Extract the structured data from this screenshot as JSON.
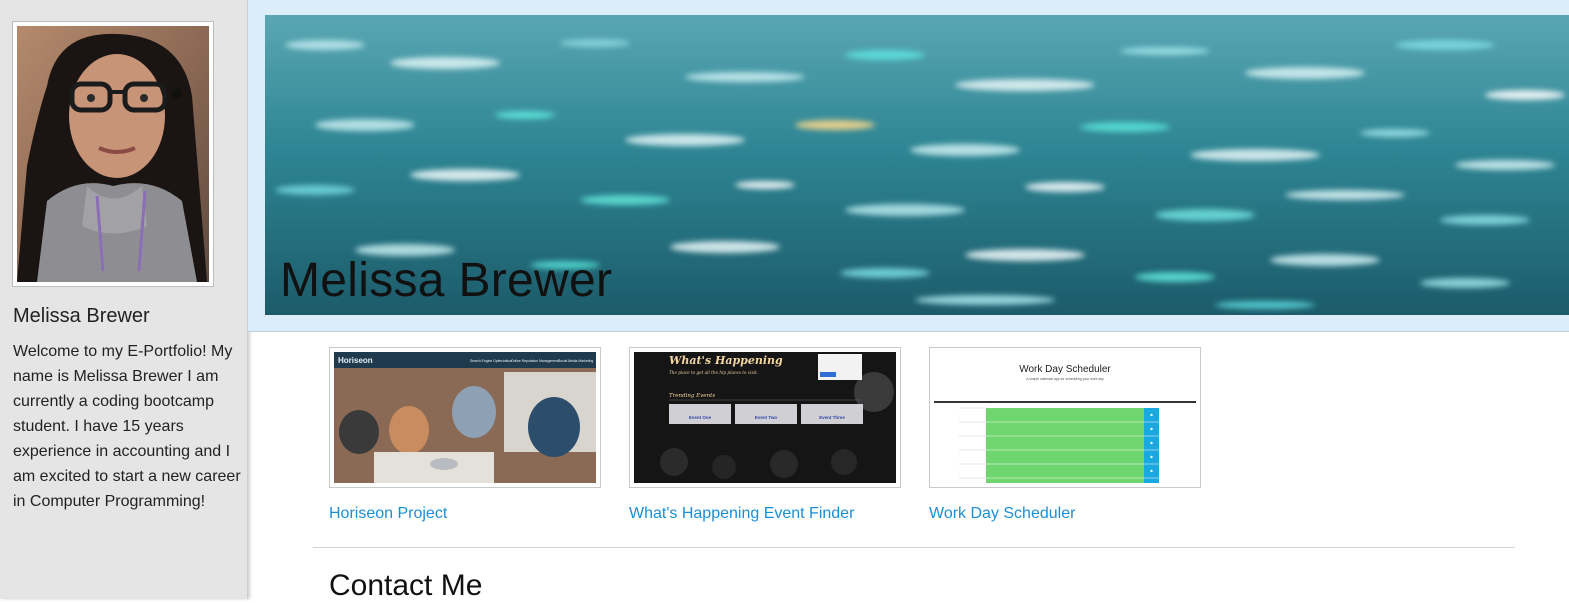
{
  "sidebar": {
    "name": "Melissa Brewer",
    "bio": "Welcome to my E-Portfolio! My name is Melissa Brewer I am currently a coding bootcamp student. I have 15 years experience in accounting and I am excited to start a new career in Computer Programming!"
  },
  "hero": {
    "title": "Melissa Brewer"
  },
  "projects": [
    {
      "label": "Horiseon Project",
      "thumb": {
        "brand": "Horiseon",
        "nav": [
          "Search Engine Optimization",
          "Online Reputation Management",
          "Social Media Marketing"
        ]
      }
    },
    {
      "label": "What's Happening Event Finder",
      "thumb": {
        "title": "What's Happening",
        "subtitle": "The place to get all the hip places to visit.",
        "section": "Trending Events",
        "events": [
          "Event One",
          "Event Two",
          "Event Three"
        ]
      }
    },
    {
      "label": "Work Day Scheduler",
      "thumb": {
        "title": "Work Day Scheduler",
        "subtitle": "A simple calendar app for scheduling your work day"
      }
    }
  ],
  "contact": {
    "heading": "Contact Me"
  },
  "colors": {
    "sidebar_bg": "#e5e5e5",
    "header_bg": "#dcecf8",
    "link": "#1a8fd6",
    "scheduler_green": "#6fd66f",
    "scheduler_blue": "#17a9e0"
  }
}
